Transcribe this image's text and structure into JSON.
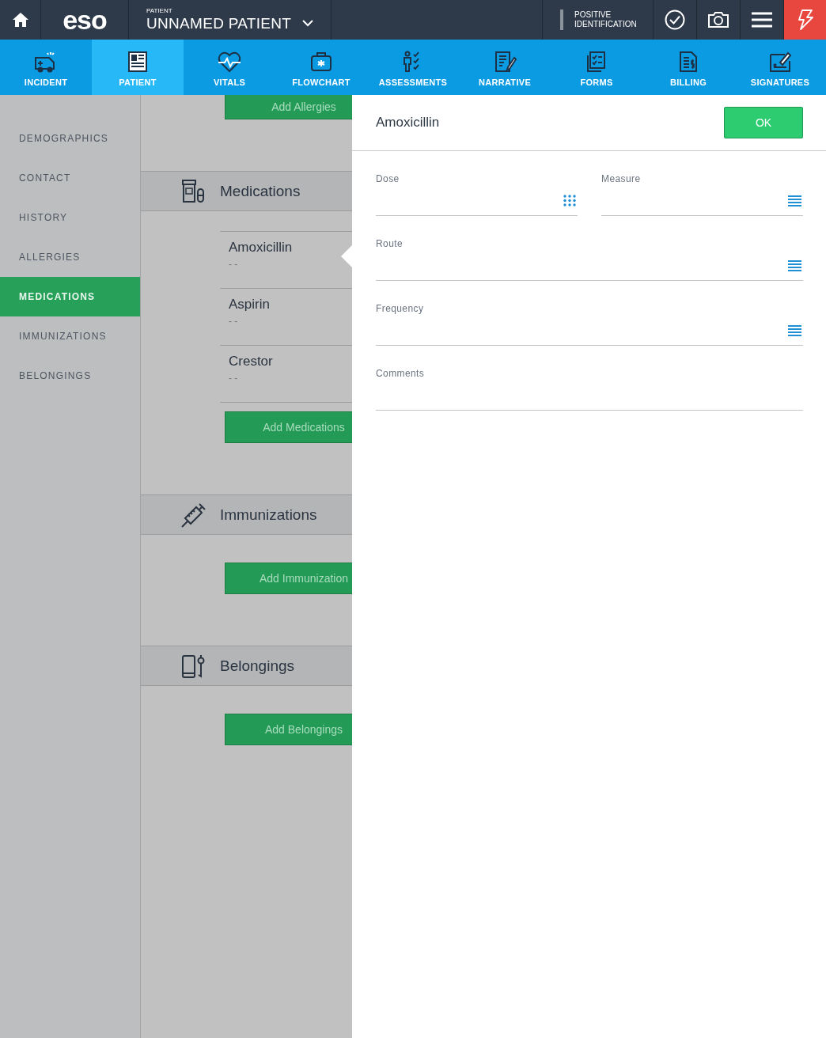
{
  "top_bar": {
    "logo": "eso",
    "patient_label": "PATIENT",
    "patient_name": "UNNAMED PATIENT",
    "identification": "POSITIVE IDENTIFICATION"
  },
  "nav_tabs": [
    {
      "label": "INCIDENT",
      "kind": "ambulance",
      "selected": false
    },
    {
      "label": "PATIENT",
      "kind": "patient",
      "selected": true
    },
    {
      "label": "VITALS",
      "kind": "vitals",
      "selected": false
    },
    {
      "label": "FLOWCHART",
      "kind": "flowchart",
      "selected": false
    },
    {
      "label": "ASSESSMENTS",
      "kind": "assessments",
      "selected": false
    },
    {
      "label": "NARRATIVE",
      "kind": "narrative",
      "selected": false
    },
    {
      "label": "FORMS",
      "kind": "forms",
      "selected": false
    },
    {
      "label": "BILLING",
      "kind": "billing",
      "selected": false
    },
    {
      "label": "SIGNATURES",
      "kind": "signatures",
      "selected": false
    }
  ],
  "sidebar": {
    "items": [
      {
        "label": "DEMOGRAPHICS",
        "selected": false
      },
      {
        "label": "CONTACT",
        "selected": false
      },
      {
        "label": "HISTORY",
        "selected": false
      },
      {
        "label": "ALLERGIES",
        "selected": false
      },
      {
        "label": "MEDICATIONS",
        "selected": true
      },
      {
        "label": "IMMUNIZATIONS",
        "selected": false
      },
      {
        "label": "BELONGINGS",
        "selected": false
      }
    ]
  },
  "sections": [
    {
      "button": "Add Allergies"
    },
    {
      "kind": "medications",
      "title": "Medications",
      "items": [
        {
          "name": "Amoxicillin",
          "detail": "- -",
          "selected": true
        },
        {
          "name": "Aspirin",
          "detail": "- -",
          "selected": false
        },
        {
          "name": "Crestor",
          "detail": "- -",
          "selected": false
        }
      ],
      "button": "Add Medications"
    },
    {
      "kind": "immunizations",
      "title": "Immunizations",
      "button": "Add Immunization"
    },
    {
      "kind": "belongings",
      "title": "Belongings",
      "button": "Add Belongings"
    }
  ],
  "detail_panel": {
    "title": "Amoxicillin",
    "ok_button": "OK",
    "fields": [
      {
        "label": "Dose",
        "kind": "keypad",
        "half": true
      },
      {
        "label": "Measure",
        "kind": "list",
        "half": true
      },
      {
        "label": "Route",
        "kind": "list",
        "half": false
      },
      {
        "label": "Frequency",
        "kind": "list",
        "half": false
      },
      {
        "label": "Comments",
        "kind": "text",
        "half": false
      }
    ]
  }
}
